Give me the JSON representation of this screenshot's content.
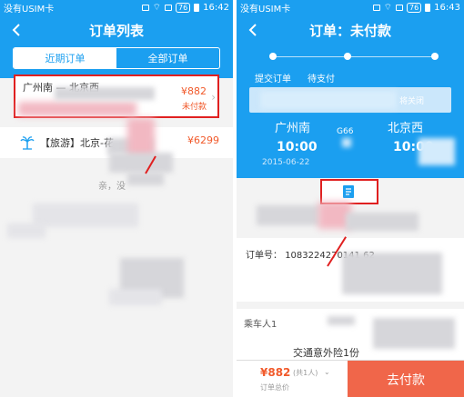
{
  "left": {
    "status": {
      "carrier": "没有USIM卡",
      "time": "16:42",
      "battery": "76"
    },
    "title": "订单列表",
    "tabs": [
      {
        "label": "近期订单",
        "active": true
      },
      {
        "label": "全部订单",
        "active": false
      }
    ],
    "order": {
      "route": "广州南 — 北京西",
      "price": "¥882",
      "status": "未付款"
    },
    "travel": {
      "title": "【旅游】北京-花",
      "price": "¥6299"
    },
    "faint_text": "亲，没"
  },
  "right": {
    "status": {
      "carrier": "没有USIM卡",
      "time": "16:43",
      "battery": "76"
    },
    "title": "订单：未付款",
    "steps": [
      "提交订单",
      "待支付"
    ],
    "close_hint": "将关闭",
    "trip": {
      "from_station": "广州南",
      "to_station": "北京西",
      "train_no": "G66",
      "depart_time": "10:00",
      "arrive_time": "10:00",
      "date": "2015-06-22"
    },
    "order_no_label": "订单号：",
    "order_no": "1083224270141 62",
    "passenger_label": "乘车人1",
    "insurance": "交通意外险1份",
    "total_price": "¥882",
    "count": "(共1人)",
    "total_label": "订单总价",
    "pay_label": "去付款"
  },
  "colors": {
    "primary": "#1b9ff0",
    "accent": "#f15a2b",
    "highlight": "#e02020",
    "pay": "#f0664a"
  }
}
